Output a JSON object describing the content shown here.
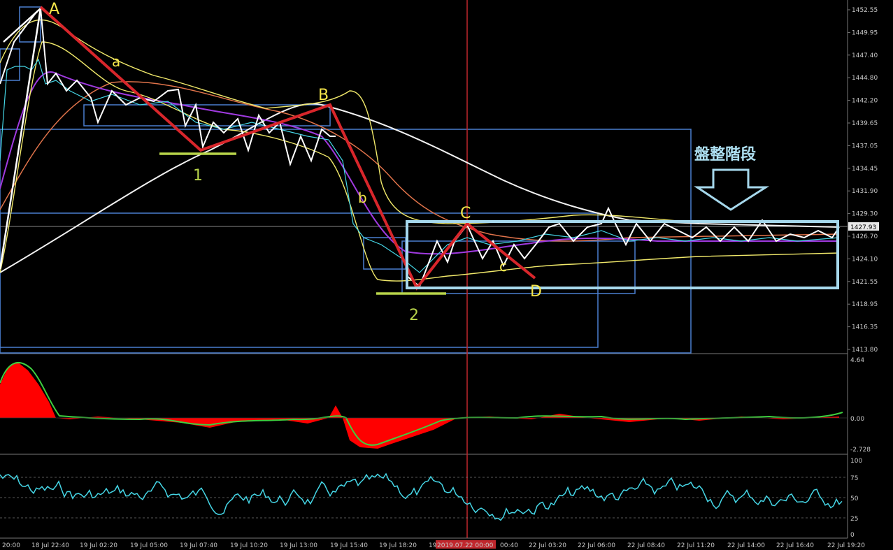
{
  "chart_data": {
    "type": "line",
    "panels": [
      {
        "name": "price",
        "price_axis": [
          "1452.55",
          "1449.95",
          "1447.40",
          "1444.80",
          "1442.20",
          "1439.65",
          "1437.05",
          "1434.45",
          "1431.90",
          "1429.30",
          "1426.70",
          "1424.10",
          "1421.55",
          "1418.95",
          "1416.35",
          "1413.80"
        ],
        "current_price": "1427.93",
        "ylim": [
          1413.8,
          1452.55
        ],
        "zigzag_points": [
          {
            "label": "A",
            "price": 1452.5
          },
          {
            "label": "a",
            "price": 1445.0
          },
          {
            "label": "1",
            "price": 1436.8
          },
          {
            "label": "B",
            "price": 1441.9
          },
          {
            "label": "b",
            "price": 1430.3
          },
          {
            "label": "2",
            "price": 1421.3
          },
          {
            "label": "C",
            "price": 1428.2
          },
          {
            "label": "c",
            "price": 1424.2
          },
          {
            "label": "D",
            "price": 1422.0
          }
        ],
        "annotation": "盤整階段"
      },
      {
        "name": "macd",
        "axis": [
          "4.64",
          "0.00",
          "-2.728"
        ]
      },
      {
        "name": "oscillator",
        "axis": [
          "100",
          "75",
          "50",
          "25",
          "0"
        ]
      }
    ],
    "time_axis": [
      "20:00",
      "18 Jul 22:40",
      "19 Jul 02:20",
      "19 Jul 05:00",
      "19 Jul 07:40",
      "19 Jul 10:20",
      "19 Jul 13:00",
      "19 Jul 15:40",
      "19 Jul 18:20",
      "19",
      "2019.07.22 00:00",
      "00:40",
      "22 Jul 03:20",
      "22 Jul 06:00",
      "22 Jul 08:40",
      "22 Jul 11:20",
      "22 Jul 14:00",
      "22 Jul 16:40",
      "22 Jul 19:20"
    ],
    "highlight_time": "2019.07.22 00:00"
  },
  "colors": {
    "zigzag": "#d8262b",
    "white_line": "#ffffff",
    "bands": "#f0e86a",
    "box": "#4a7fd0",
    "range_box": "#a6d8ec",
    "macd_hist": "#ff0000",
    "macd_signal": "#3fcf3f",
    "oscillator": "#45d6e6",
    "vline": "#c0272d"
  }
}
